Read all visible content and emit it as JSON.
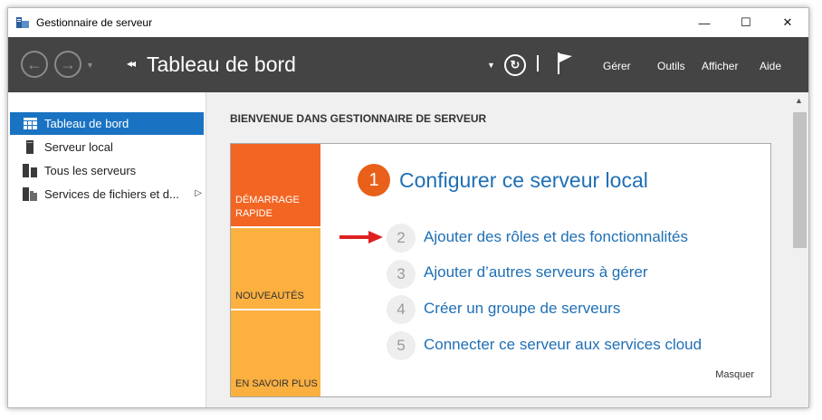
{
  "window": {
    "title": "Gestionnaire de serveur",
    "minimize": "—",
    "maximize": "☐",
    "close": "✕"
  },
  "toolbar": {
    "back_icon": "←",
    "forward_icon": "→",
    "nav_dropdown": "▼",
    "breadcrumb_arrows": "◂◂",
    "breadcrumb_title": "Tableau de bord",
    "refresh_dropdown": "▼",
    "refresh_icon": "↻",
    "menus": [
      "Gérer",
      "Outils",
      "Afficher",
      "Aide"
    ]
  },
  "sidebar": {
    "items": [
      {
        "label": "Tableau de bord",
        "icon": "dashboard-icon",
        "active": true
      },
      {
        "label": "Serveur local",
        "icon": "server-icon",
        "active": false
      },
      {
        "label": "Tous les serveurs",
        "icon": "servers-icon",
        "active": false
      },
      {
        "label": "Services de fichiers et d...",
        "icon": "file-services-icon",
        "active": false,
        "chevron": "▷"
      }
    ]
  },
  "main": {
    "welcome": "BIENVENUE DANS GESTIONNAIRE DE SERVEUR",
    "tiles": [
      {
        "line1": "DÉMARRAGE",
        "line2": "RAPIDE",
        "color": "#f26522"
      },
      {
        "line1": "NOUVEAUTÉS",
        "line2": "",
        "color": "#fbb040"
      },
      {
        "line1": "EN SAVOIR PLUS",
        "line2": "",
        "color": "#fbb040"
      }
    ],
    "steps": [
      {
        "num": "1",
        "text": "Configurer ce serveur local"
      },
      {
        "num": "2",
        "text": "Ajouter des rôles et des fonctionnalités"
      },
      {
        "num": "3",
        "text": "Ajouter d’autres serveurs à gérer"
      },
      {
        "num": "4",
        "text": "Créer un groupe de serveurs"
      },
      {
        "num": "5",
        "text": "Connecter ce serveur aux services cloud"
      }
    ],
    "hide_label": "Masquer"
  },
  "scrollbar": {
    "up_icon": "▲"
  },
  "colors": {
    "toolbar_bg": "#444444",
    "accent_blue": "#1a73c2",
    "link_blue": "#1f6fb5",
    "orange": "#e8601a",
    "arrow_red": "#e02020"
  }
}
